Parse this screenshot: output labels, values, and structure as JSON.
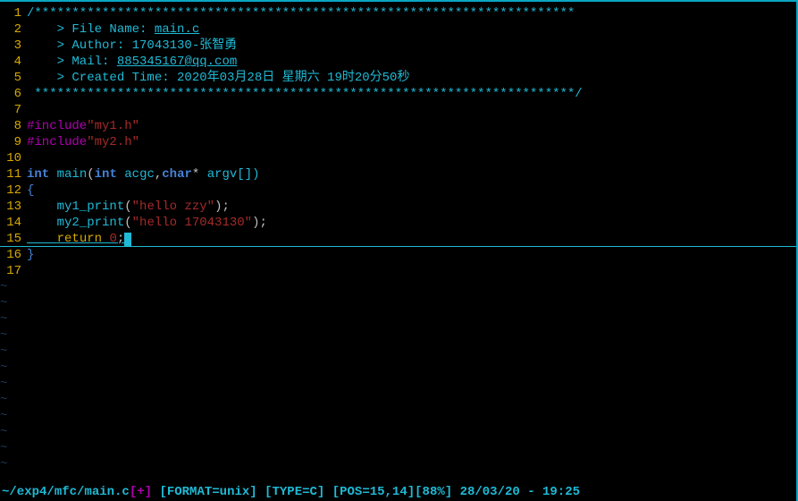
{
  "lines": {
    "count": 17,
    "l1a": "/************************************************************************",
    "l2a": "    > File Name: ",
    "l2b": "main.c",
    "l3a": "    > Author: 17043130-张智勇",
    "l4a": "    > Mail: ",
    "l4b": "885345167@qq.com",
    "l5a": "    > Created Time: 2020年03月28日 星期六 19时20分50秒",
    "l6a": " ************************************************************************/",
    "l8a": "#include",
    "l8b": "\"my1.h\"",
    "l9a": "#include",
    "l9b": "\"my2.h\"",
    "l11_int": "int",
    "l11_main": " main",
    "l11_op": "(",
    "l11_int2": "int",
    "l11_arg1": " acgc",
    "l11_comma": ",",
    "l11_char": "char",
    "l11_star": "*",
    "l11_arg2": " argv[])",
    "l12": "{",
    "l13_indent": "    ",
    "l13_fn": "my1_print",
    "l13_op": "(",
    "l13_str": "\"hello zzy\"",
    "l13_cl": ");",
    "l14_indent": "    ",
    "l14_fn": "my2_print",
    "l14_op": "(",
    "l14_str": "\"hello 17043130\"",
    "l14_cl": ");",
    "l15_indent": "    ",
    "l15_ret": "return",
    "l15_sp": " ",
    "l15_num": "0",
    "l15_semi": ";",
    "l16": "}",
    "tilde": "~"
  },
  "status": {
    "tilde": "~",
    "path": "/exp4/mfc/main.c",
    "modified": "[+]",
    "format_lbl": "[FORMAT=",
    "format_val": "unix",
    "type_lbl": "] [TYPE=",
    "type_val": "C",
    "pos_lbl": "] [POS=",
    "pos_val": "15,14",
    "pct_lbl": "][",
    "pct_val": "88%",
    "date_lbl": "] ",
    "date_val": "28/03/20 - 19:25"
  }
}
